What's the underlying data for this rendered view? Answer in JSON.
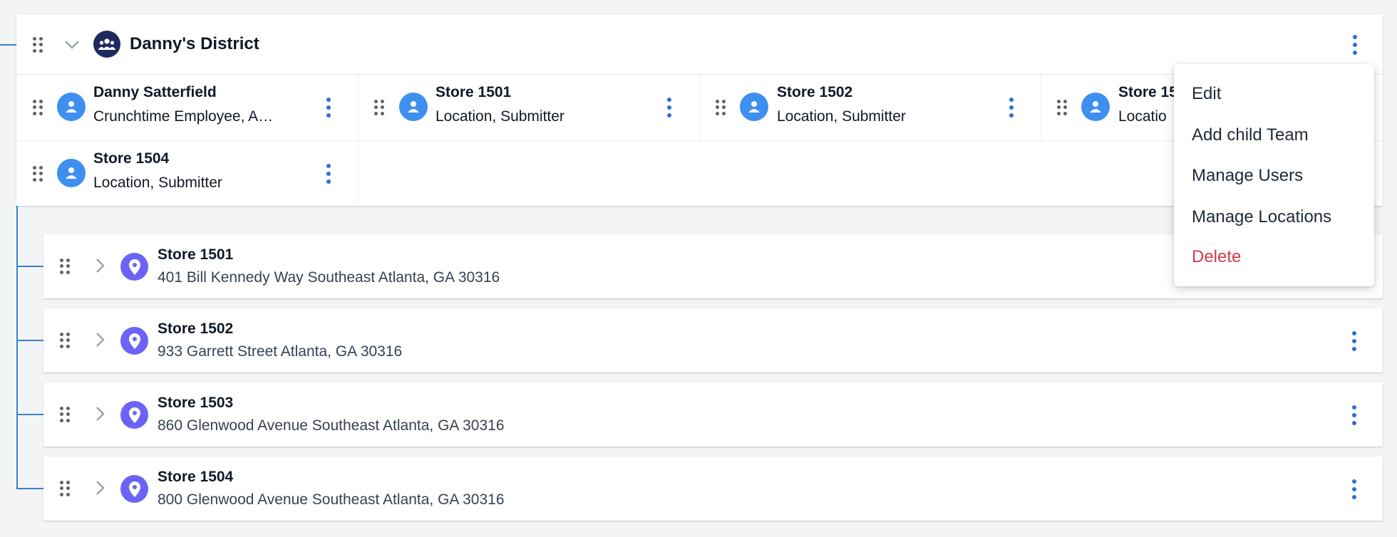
{
  "team": {
    "title": "Danny's District",
    "icon": "team-icon",
    "members": [
      {
        "name": "Danny Satterfield",
        "role": "Crunchtime Employee, A…"
      },
      {
        "name": "Store 1501",
        "role": "Location, Submitter"
      },
      {
        "name": "Store 1502",
        "role": "Location, Submitter"
      },
      {
        "name": "Store 15",
        "role": "Locatio"
      },
      {
        "name": "Store 1504",
        "role": "Location, Submitter"
      }
    ]
  },
  "locations": [
    {
      "name": "Store 1501",
      "address": "401 Bill Kennedy Way Southeast Atlanta, GA 30316"
    },
    {
      "name": "Store 1502",
      "address": "933 Garrett Street Atlanta, GA 30316"
    },
    {
      "name": "Store 1503",
      "address": "860 Glenwood Avenue Southeast Atlanta, GA 30316"
    },
    {
      "name": "Store 1504",
      "address": "800 Glenwood Avenue Southeast Atlanta, GA 30316"
    }
  ],
  "menu": {
    "items": [
      "Edit",
      "Add child Team",
      "Manage Users",
      "Manage Locations",
      "Delete"
    ]
  },
  "colors": {
    "accent": "#2f6fd0",
    "team_avatar": "#1e2a5e",
    "person_avatar": "#3d8ff0",
    "location_avatar": "#6b63f5",
    "danger": "#d33a4f",
    "tree_line": "#3b82c4"
  }
}
